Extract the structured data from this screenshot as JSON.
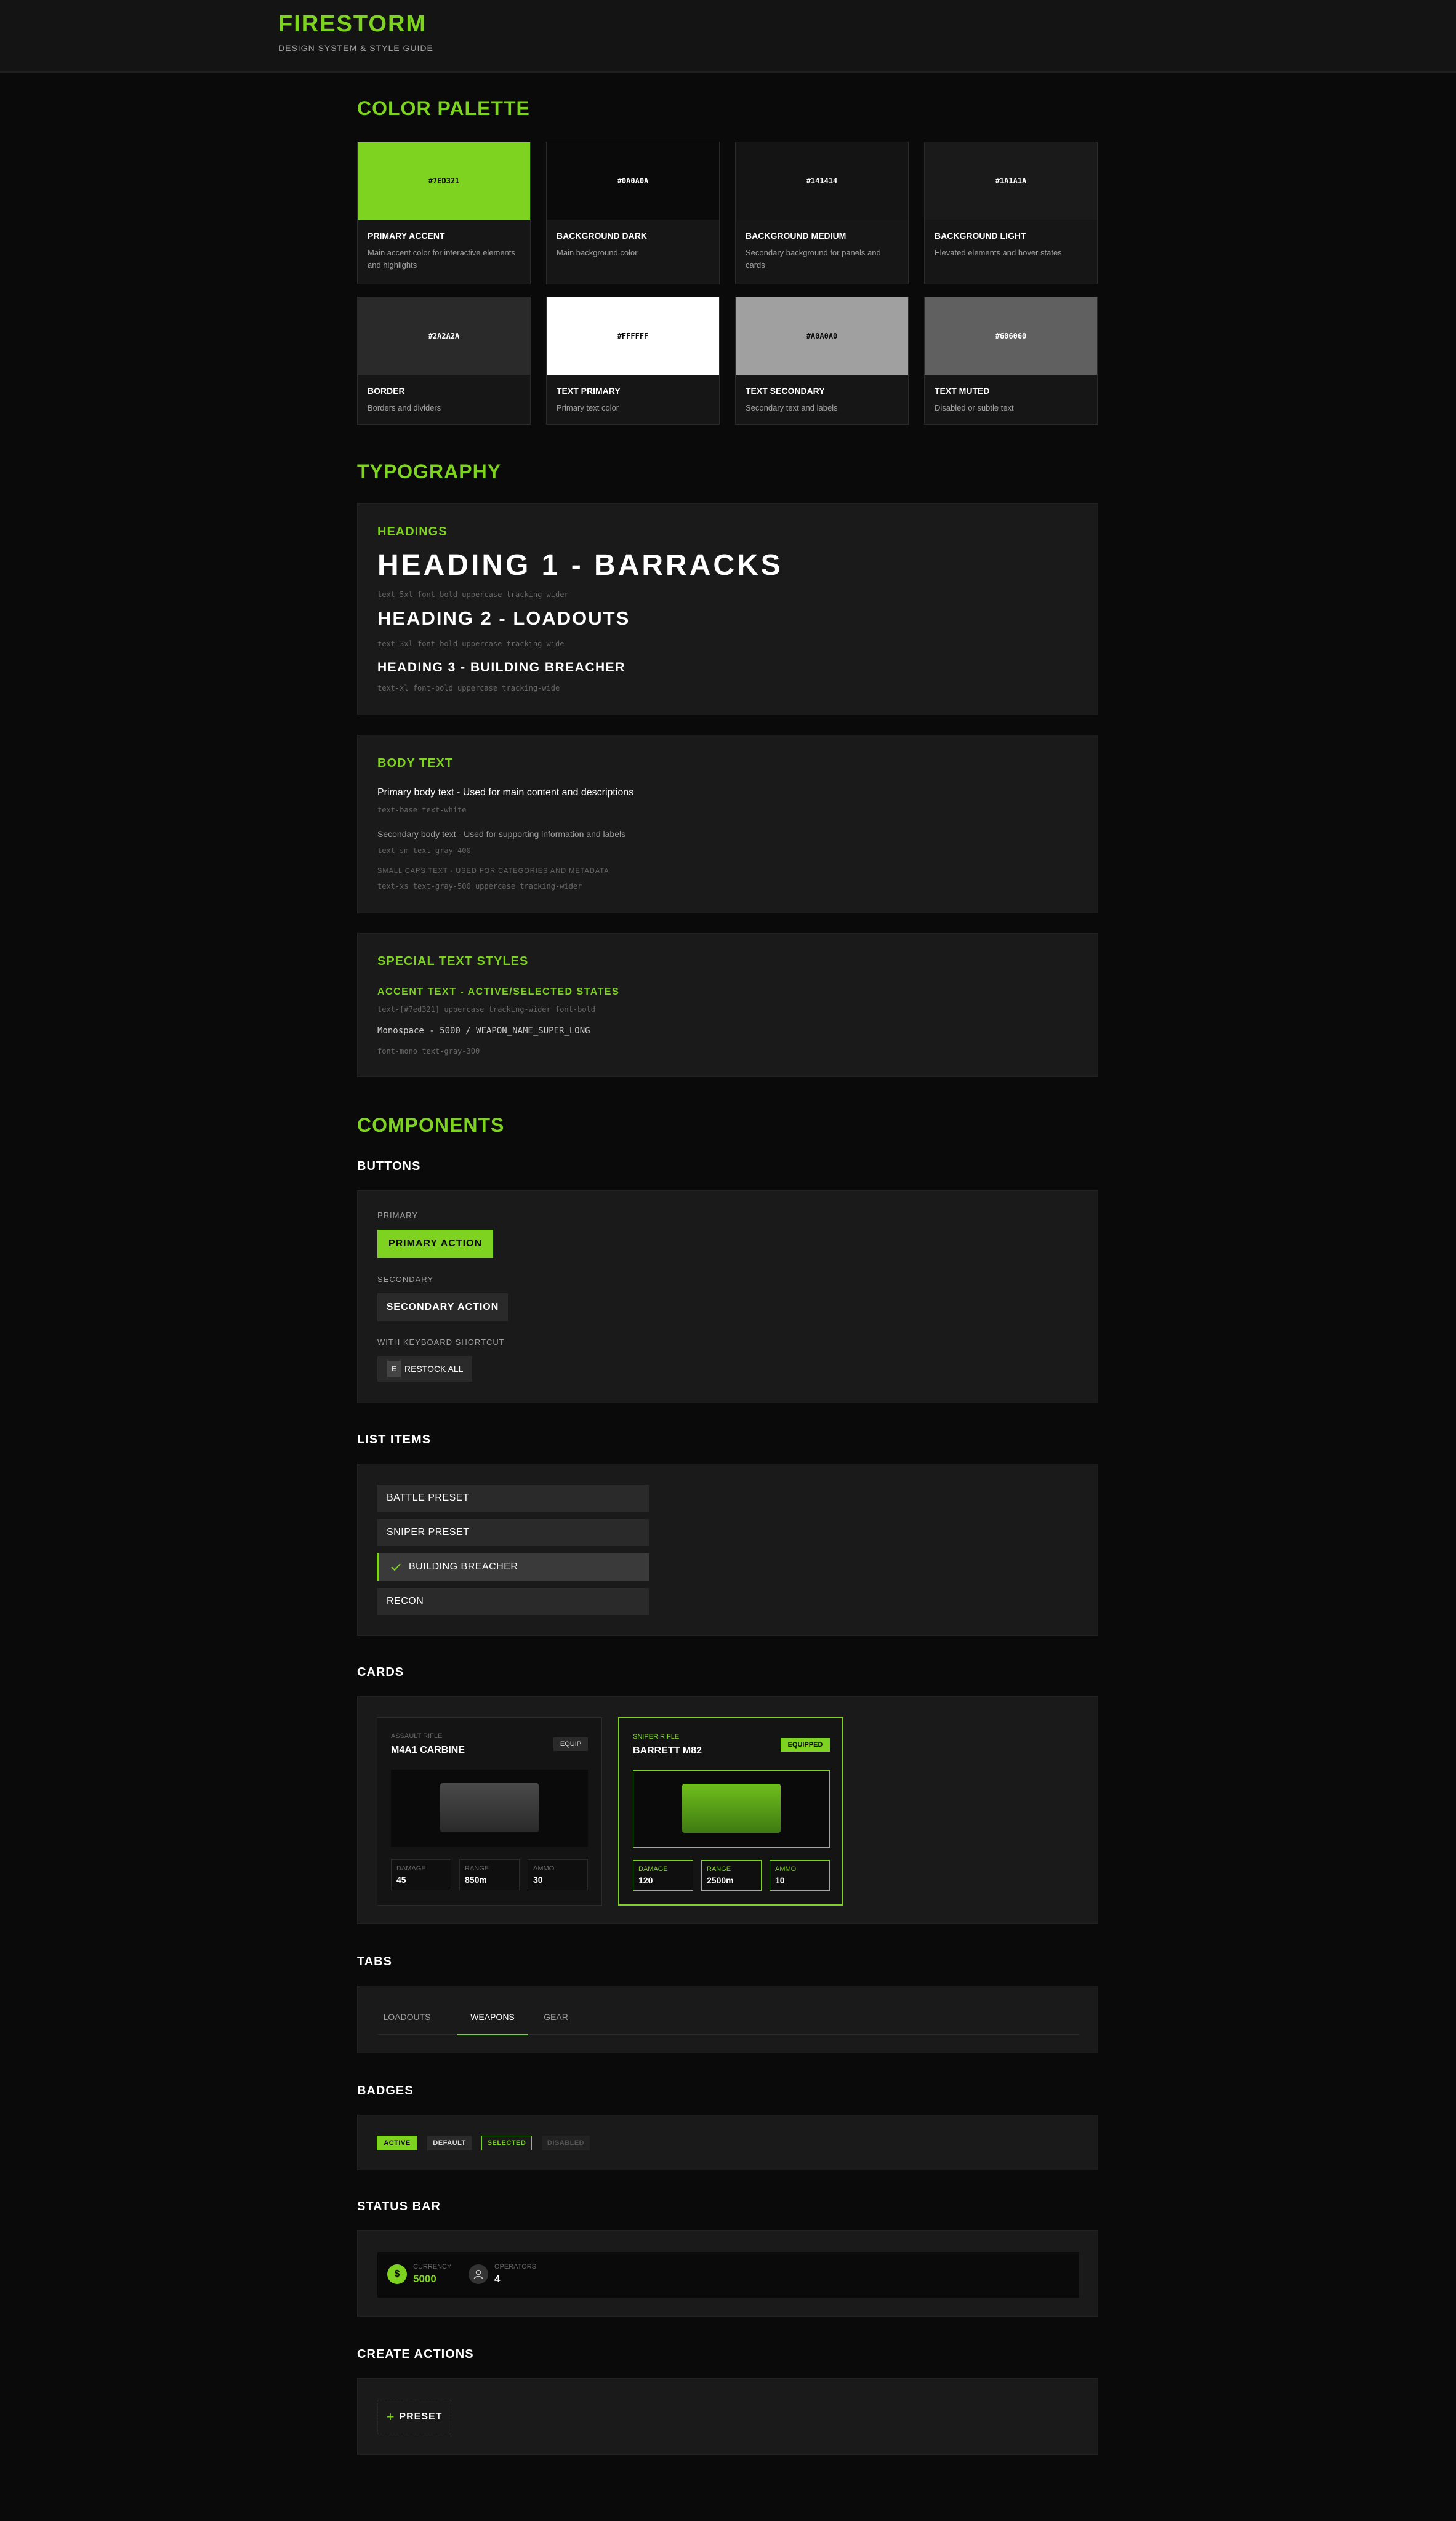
{
  "header": {
    "brand": "FIRESTORM",
    "subtitle": "DESIGN SYSTEM & STYLE GUIDE"
  },
  "sections": {
    "color_palette": "COLOR PALETTE",
    "typography": "TYPOGRAPHY",
    "components": "COMPONENTS"
  },
  "palette": [
    {
      "hex": "#7ED321",
      "name": "PRIMARY ACCENT",
      "desc": "Main accent color for interactive elements and highlights",
      "bg": "#7ED321",
      "fg": "#0A0A0A"
    },
    {
      "hex": "#0A0A0A",
      "name": "BACKGROUND DARK",
      "desc": "Main background color",
      "bg": "#0A0A0A",
      "fg": "#FFFFFF"
    },
    {
      "hex": "#141414",
      "name": "BACKGROUND MEDIUM",
      "desc": "Secondary background for panels and cards",
      "bg": "#141414",
      "fg": "#FFFFFF"
    },
    {
      "hex": "#1A1A1A",
      "name": "BACKGROUND LIGHT",
      "desc": "Elevated elements and hover states",
      "bg": "#1A1A1A",
      "fg": "#FFFFFF"
    },
    {
      "hex": "#2A2A2A",
      "name": "BORDER",
      "desc": "Borders and dividers",
      "bg": "#2A2A2A",
      "fg": "#FFFFFF"
    },
    {
      "hex": "#FFFFFF",
      "name": "TEXT PRIMARY",
      "desc": "Primary text color",
      "bg": "#FFFFFF",
      "fg": "#0A0A0A"
    },
    {
      "hex": "#A0A0A0",
      "name": "TEXT SECONDARY",
      "desc": "Secondary text and labels",
      "bg": "#A0A0A0",
      "fg": "#0A0A0A"
    },
    {
      "hex": "#606060",
      "name": "TEXT MUTED",
      "desc": "Disabled or subtle text",
      "bg": "#606060",
      "fg": "#FFFFFF"
    }
  ],
  "typography": {
    "headings_label": "HEADINGS",
    "h1": "HEADING 1 - BARRACKS",
    "h1_code": "text-5xl font-bold uppercase tracking-wider",
    "h2": "HEADING 2 - LOADOUTS",
    "h2_code": "text-3xl font-bold uppercase tracking-wide",
    "h3": "HEADING 3 - BUILDING BREACHER",
    "h3_code": "text-xl font-bold uppercase tracking-wide",
    "body_label": "BODY TEXT",
    "body_primary": "Primary body text - Used for main content and descriptions",
    "body_primary_code": "text-base text-white",
    "body_secondary": "Secondary body text - Used for supporting information and labels",
    "body_secondary_code": "text-sm text-gray-400",
    "small_caps": "SMALL CAPS TEXT - USED FOR CATEGORIES AND METADATA",
    "small_caps_code": "text-xs text-gray-500 uppercase tracking-wider",
    "special_label": "SPECIAL TEXT STYLES",
    "accent_text": "ACCENT TEXT - ACTIVE/SELECTED STATES",
    "accent_code": "text-[#7ed321] uppercase tracking-wider font-bold",
    "mono_text": "Monospace - 5000 / WEAPON_NAME_SUPER_LONG",
    "mono_code": "font-mono text-gray-300"
  },
  "buttons": {
    "title": "BUTTONS",
    "primary_label": "PRIMARY",
    "primary_text": "PRIMARY ACTION",
    "secondary_label": "SECONDARY",
    "secondary_text": "SECONDARY ACTION",
    "shortcut_label": "WITH KEYBOARD SHORTCUT",
    "shortcut_key": "E",
    "shortcut_text": "RESTOCK ALL"
  },
  "list_items": {
    "title": "LIST ITEMS",
    "items": [
      "BATTLE PRESET",
      "SNIPER PRESET",
      "BUILDING BREACHER",
      "RECON"
    ],
    "selected_index": 2
  },
  "cards": {
    "title": "CARDS",
    "items": [
      {
        "category": "ASSAULT RIFLE",
        "name": "M4A1 CARBINE",
        "action": "EQUIP",
        "stats": [
          {
            "k": "DAMAGE",
            "v": "45"
          },
          {
            "k": "RANGE",
            "v": "850m"
          },
          {
            "k": "AMMO",
            "v": "30"
          }
        ]
      },
      {
        "category": "SNIPER RIFLE",
        "name": "BARRETT M82",
        "action": "EQUIPPED",
        "stats": [
          {
            "k": "DAMAGE",
            "v": "120"
          },
          {
            "k": "RANGE",
            "v": "2500m"
          },
          {
            "k": "AMMO",
            "v": "10"
          }
        ]
      }
    ]
  },
  "tabs": {
    "title": "TABS",
    "items": [
      "LOADOUTS",
      "WEAPONS",
      "GEAR"
    ],
    "active_index": 1
  },
  "badges": {
    "title": "BADGES",
    "items": [
      "ACTIVE",
      "DEFAULT",
      "SELECTED",
      "DISABLED"
    ]
  },
  "status_bar": {
    "title": "STATUS BAR",
    "currency_icon": "$",
    "currency_label": "CURRENCY",
    "currency_value": "5000",
    "operators_label": "OPERATORS",
    "operators_value": "4"
  },
  "create_actions": {
    "title": "CREATE ACTIONS",
    "plus": "+",
    "preset": "PRESET"
  },
  "colors": {
    "accent": "#7ED321",
    "bg_dark": "#0A0A0A",
    "bg_medium": "#141414",
    "bg_light": "#1A1A1A",
    "border": "#2A2A2A"
  }
}
